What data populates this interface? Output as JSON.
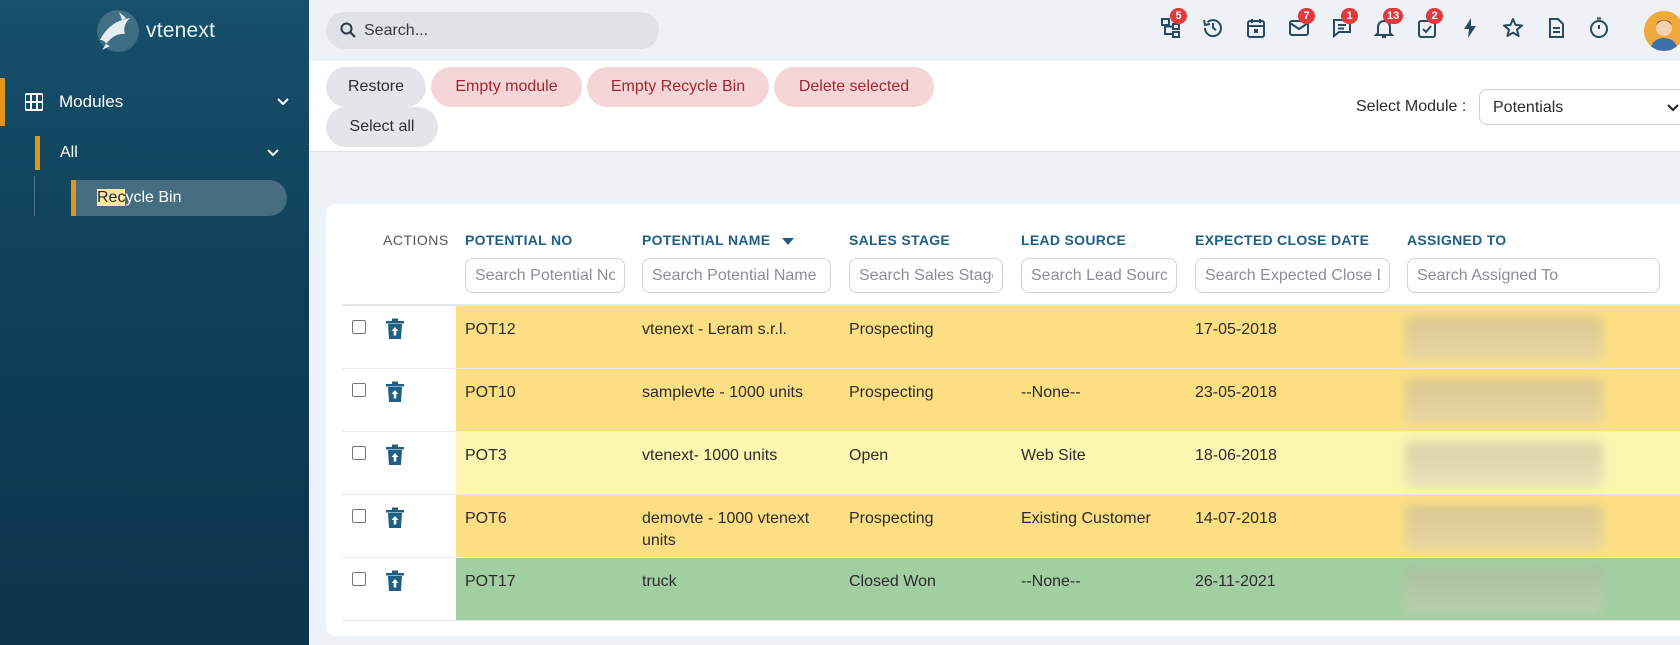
{
  "sidebar": {
    "logo_text": "vtenext",
    "modules_label": "Modules",
    "all_label": "All",
    "recycle_bin_hl": "Rec",
    "recycle_bin_rest": "ycle Bin"
  },
  "topbar": {
    "search_placeholder": "Search...",
    "icons": [
      {
        "name": "org-tree-icon",
        "badge": "5"
      },
      {
        "name": "history-icon",
        "badge": ""
      },
      {
        "name": "calendar-icon",
        "badge": ""
      },
      {
        "name": "mail-icon",
        "badge": "7"
      },
      {
        "name": "chat-icon",
        "badge": "1"
      },
      {
        "name": "bell-icon",
        "badge": "13"
      },
      {
        "name": "task-check-icon",
        "badge": "2"
      },
      {
        "name": "lightning-icon",
        "badge": ""
      },
      {
        "name": "star-icon",
        "badge": ""
      },
      {
        "name": "document-icon",
        "badge": ""
      },
      {
        "name": "timer-icon",
        "badge": ""
      }
    ]
  },
  "toolbar": {
    "restore": "Restore",
    "empty_module": "Empty module",
    "empty_recycle_bin": "Empty Recycle Bin",
    "delete_selected": "Delete selected",
    "select_all": "Select all",
    "select_module_label": "Select Module :",
    "select_module_value": "Potentials"
  },
  "table": {
    "headers": {
      "actions": "ACTIONS",
      "potential_no": "POTENTIAL NO",
      "potential_name": "POTENTIAL NAME",
      "sales_stage": "SALES STAGE",
      "lead_source": "LEAD SOURCE",
      "expected_close_date": "EXPECTED CLOSE DATE",
      "assigned_to": "ASSIGNED TO"
    },
    "filters": {
      "potential_no": "Search Potential No",
      "potential_name": "Search Potential Name",
      "sales_stage": "Search Sales Stage",
      "lead_source": "Search Lead Source",
      "expected_close_date": "Search Expected Close Date",
      "assigned_to": "Search Assigned To"
    },
    "rows": [
      {
        "no": "POT12",
        "name": "vtenext - Leram s.r.l.",
        "stage": "Prospecting",
        "source": "",
        "date": "17-05-2018",
        "color": "#fddf83"
      },
      {
        "no": "POT10",
        "name": "samplevte - 1000 units",
        "stage": "Prospecting",
        "source": "--None--",
        "date": "23-05-2018",
        "color": "#fddf83"
      },
      {
        "no": "POT3",
        "name": "vtenext- 1000 units",
        "stage": "Open",
        "source": "Web Site",
        "date": "18-06-2018",
        "color": "#fdf6b0"
      },
      {
        "no": "POT6",
        "name": "demovte - 1000 vtenext units",
        "stage": "Prospecting",
        "source": "Existing Customer",
        "date": "14-07-2018",
        "color": "#fddf83"
      },
      {
        "no": "POT17",
        "name": "truck",
        "stage": "Closed Won",
        "source": "--None--",
        "date": "26-11-2021",
        "color": "#a1cfa2"
      }
    ]
  }
}
